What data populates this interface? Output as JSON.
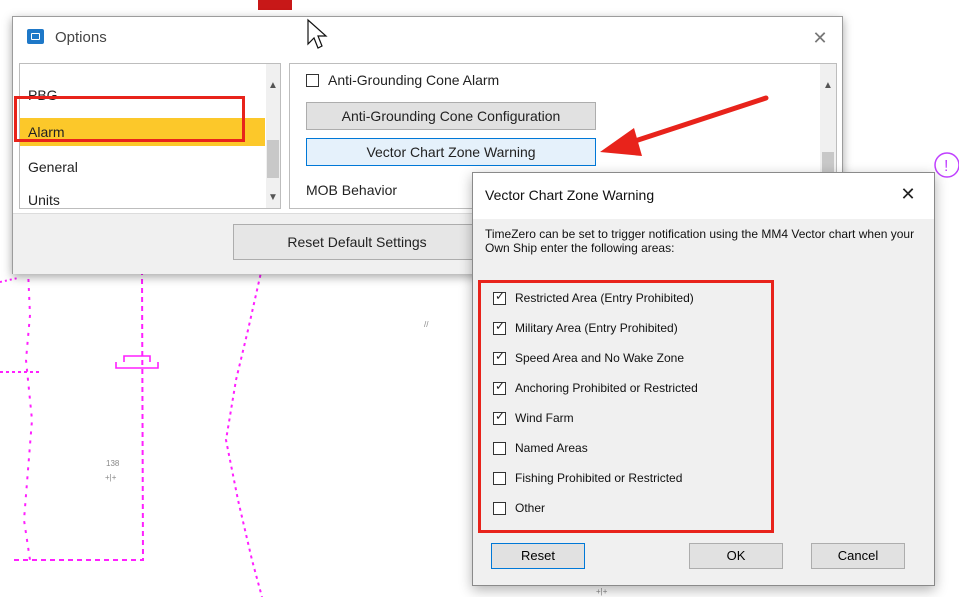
{
  "options_window": {
    "title": "Options",
    "close_glyph": "✕",
    "categories": [
      {
        "label": "PBG"
      },
      {
        "label": "Alarm"
      },
      {
        "label": "General"
      },
      {
        "label": "Units"
      }
    ],
    "selected_category": "Alarm",
    "settings": {
      "anti_grounding_alarm_label": "Anti-Grounding Cone Alarm",
      "anti_grounding_alarm_checked": false,
      "anti_grounding_config_button": "Anti-Grounding Cone Configuration",
      "vector_chart_button": "Vector Chart Zone Warning",
      "mob_behavior_label": "MOB Behavior"
    },
    "reset_default_button": "Reset Default Settings"
  },
  "dialog": {
    "title": "Vector Chart Zone Warning",
    "close_glyph": "✕",
    "description": "TimeZero can be set to trigger notification using the MM4 Vector chart when your Own Ship enter the following areas:",
    "areas": [
      {
        "label": "Restricted Area (Entry Prohibited)",
        "checked": true
      },
      {
        "label": "Military Area (Entry Prohibited)",
        "checked": true
      },
      {
        "label": "Speed Area and No Wake Zone",
        "checked": true
      },
      {
        "label": "Anchoring Prohibited or Restricted",
        "checked": true
      },
      {
        "label": "Wind Farm",
        "checked": true
      },
      {
        "label": "Named Areas",
        "checked": false
      },
      {
        "label": "Fishing Prohibited or Restricted",
        "checked": false
      },
      {
        "label": "Other",
        "checked": false
      }
    ],
    "buttons": {
      "reset": "Reset",
      "ok": "OK",
      "cancel": "Cancel"
    }
  },
  "chart": {
    "depth_label": "138",
    "warning_glyph": "!"
  },
  "colors": {
    "highlight_red": "#e8231b",
    "selection_yellow": "#fcc82a",
    "chart_magenta": "#ff20ff",
    "focus_blue": "#0078d7"
  },
  "icons": [
    "app-icon",
    "close-icon",
    "scroll-up-icon",
    "scroll-down-icon",
    "checkbox-icon",
    "red-arrow",
    "cursor-icon",
    "warning-icon"
  ]
}
